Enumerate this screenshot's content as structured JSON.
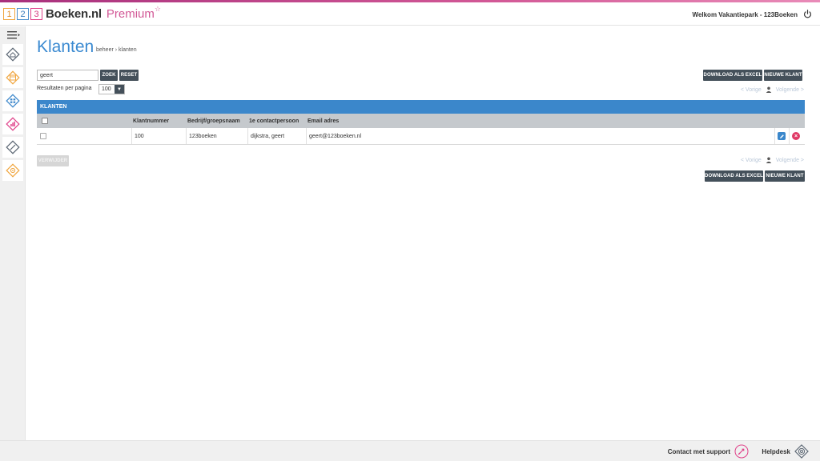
{
  "header": {
    "logo_digits": [
      "1",
      "2",
      "3"
    ],
    "logo_name": "Boeken.nl",
    "logo_premium": "Premium",
    "logo_star": "☆",
    "welcome": "Welkom Vakantiepark - 123Boeken"
  },
  "page": {
    "title": "Klanten",
    "breadcrumb": "beheer › klanten"
  },
  "search": {
    "value": "geert",
    "zoek_label": "ZOEK",
    "reset_label": "RESET"
  },
  "results_per_page": {
    "label": "Resultaten per pagina",
    "value": "100"
  },
  "actions": {
    "download_label": "DOWNLOAD ALS EXCEL",
    "new_label": "NIEUWE KLANT",
    "delete_label": "VERWIJDER"
  },
  "pager": {
    "prev": "< Vorige",
    "next": "Volgende >"
  },
  "table": {
    "title": "KLANTEN",
    "columns": [
      "Klantnummer",
      "Bedrijf/groepsnaam",
      "1e contactpersoon",
      "Email adres"
    ],
    "rows": [
      {
        "klantnummer": "100",
        "bedrijf": "123boeken",
        "contact": "dijkstra, geert",
        "email": "geert@123boeken.nl"
      }
    ]
  },
  "footer": {
    "contact": "Contact met support",
    "helpdesk": "Helpdesk"
  },
  "colors": {
    "accent_blue": "#3b87cb",
    "brand_pink": "#d25896",
    "button_dark": "#44505a"
  },
  "icons": {
    "power": "power-icon",
    "menu": "menu-toggle-icon",
    "sidebar": [
      "home-icon",
      "calendar-icon",
      "layout-icon",
      "stats-icon",
      "tag-icon",
      "settings-icon"
    ],
    "rocket": "rocket-icon",
    "lifebuoy": "lifebuoy-icon"
  }
}
